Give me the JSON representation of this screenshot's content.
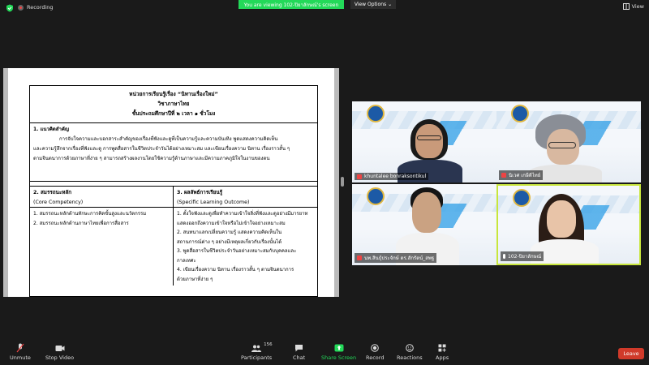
{
  "topbar": {
    "recording_label": "Recording",
    "banner_text": "You are viewing 102-ปิยาลักษณ์'s screen",
    "view_options_label": "View Options",
    "view_label": "View"
  },
  "document": {
    "title_line1": "หน่วยการเรียนรู้เรื่อง “นิทานเรื่องใหม่”",
    "title_line2": "วิชาภาษาไทย",
    "title_line3": "ชั้นประถมศึกษาปีที่ ๒ เวลา ๑ ชั่วโมง",
    "section1_title": "1. แนวคิดสำคัญ",
    "section1_line1": "การจับใจความและบอกสาระสำคัญของเรื่องที่ฟังและดูที่เป็นความรู้และความบันเทิง พูดแสดงความคิดเห็น",
    "section1_line2": "และความรู้สึกจากเรื่องที่ฟังและดู การพูดสื่อสารในชีวิตประจำวันได้อย่างเหมาะสม และเขียนเรื่องความ นิทาน เรื่องราวสั้น ๆ",
    "section1_line3": "ตามจินตนาการด้วยภาษาที่ง่าย ๆ สามารถสร้างผลงานโดยใช้ความรู้ด้านภาษาและมีความภาคภูมิใจในงานของตน",
    "col1_head_line1": "2. สมรรถนะหลัก",
    "col1_head_line2": "(Core Competency)",
    "col1_items": [
      "1. สมรรถนะหลักด้านทักษะการคิดขั้นสูงและนวัตกรรม",
      "2. สมรรถนะหลักด้านภาษาไทยเพื่อการสื่อสาร"
    ],
    "col2_head_line1": "3. ผลลัพธ์การเรียนรู้",
    "col2_head_line2": "(Specific Learning Outcome)",
    "col2_items": [
      "1. ตั้งใจฟังและดูเพื่อทำความเข้าใจสิ่งที่ฟังและดูอย่างมีมารยาท",
      "แสดงออกถึงความเข้าใจหรือไม่เข้าใจอย่างเหมาะสม",
      "2. สนทนาแลกเปลี่ยนความรู้ แสดงความคิดเห็นใน",
      "สถานการณ์ต่าง ๆ อย่างมีเหตุผลเกี่ยวกับเรื่องนั้นได้",
      "3. พูดสื่อสารในชีวิตประจำวันอย่างเหมาะสมกับบุคคลและ",
      "กาลเทศะ",
      "4. เขียนเรื่องความ นิทาน เรื่องราวสั้น ๆ ตามจินตนาการ",
      "ด้วยภาษาที่ง่าย ๆ"
    ]
  },
  "participants": [
    {
      "name": "khuntalee bonraksontikul",
      "muted": true
    },
    {
      "name": "นิเวศ เกษีติไทย์",
      "muted": true
    },
    {
      "name": "นพ.สินธุ์ประจักษ์ ดร.สักรัตน์_สพฐ",
      "muted": true
    },
    {
      "name": "102-ปิยาลักษณ์",
      "muted": false
    }
  ],
  "toolbar": {
    "unmute_label": "Unmute",
    "stop_video_label": "Stop Video",
    "participants_label": "Participants",
    "participants_count": "156",
    "chat_label": "Chat",
    "share_label": "Share Screen",
    "record_label": "Record",
    "reactions_label": "Reactions",
    "apps_label": "Apps",
    "leave_label": "Leave"
  },
  "colors": {
    "banner": "#23d959",
    "leave": "#d03a2a",
    "active_speaker": "#c8e63c"
  }
}
